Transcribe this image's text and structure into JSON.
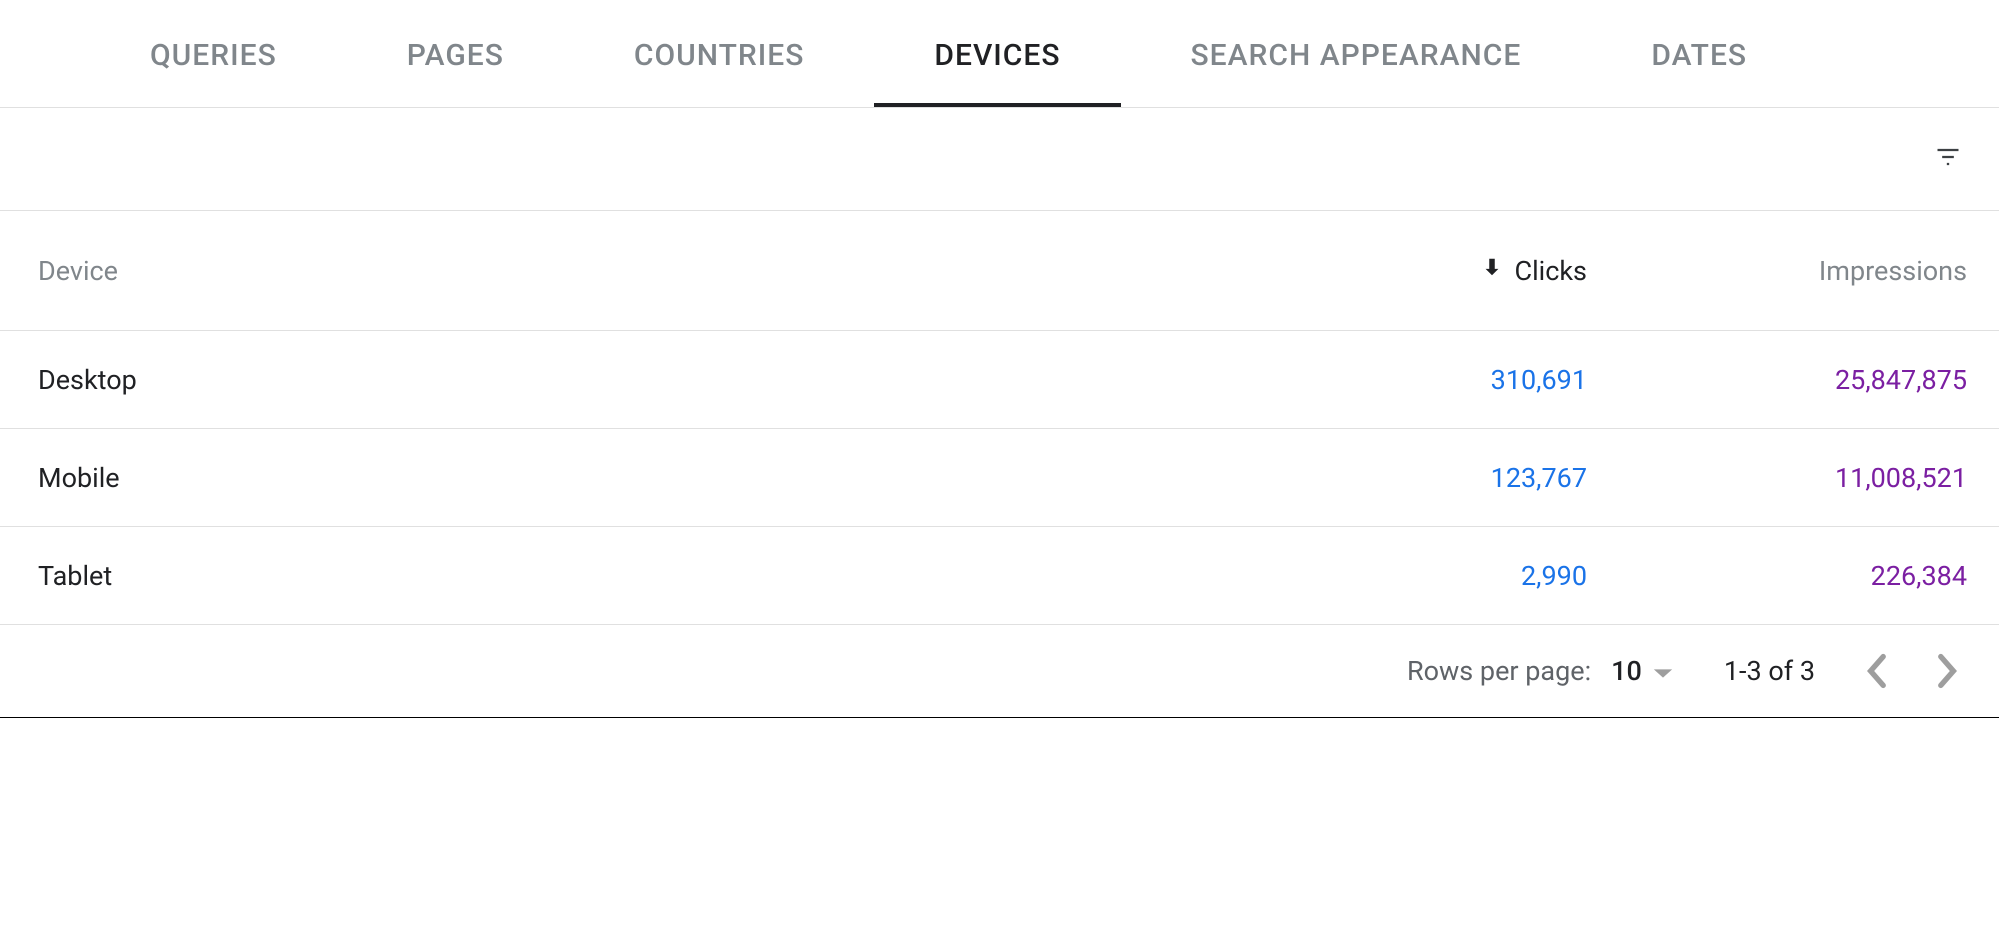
{
  "tabs": [
    "QUERIES",
    "PAGES",
    "COUNTRIES",
    "DEVICES",
    "SEARCH APPEARANCE",
    "DATES"
  ],
  "active_tab_index": 3,
  "columns": {
    "device": "Device",
    "clicks": "Clicks",
    "impressions": "Impressions"
  },
  "sort": {
    "column": "clicks",
    "direction": "desc"
  },
  "rows": [
    {
      "device": "Desktop",
      "clicks": "310,691",
      "impressions": "25,847,875"
    },
    {
      "device": "Mobile",
      "clicks": "123,767",
      "impressions": "11,008,521"
    },
    {
      "device": "Tablet",
      "clicks": "2,990",
      "impressions": "226,384"
    }
  ],
  "pagination": {
    "rows_per_page_label": "Rows per page:",
    "rows_per_page_value": "10",
    "range": "1-3 of 3"
  },
  "colors": {
    "clicks": "#1a73e8",
    "impressions": "#7b1fa2"
  }
}
